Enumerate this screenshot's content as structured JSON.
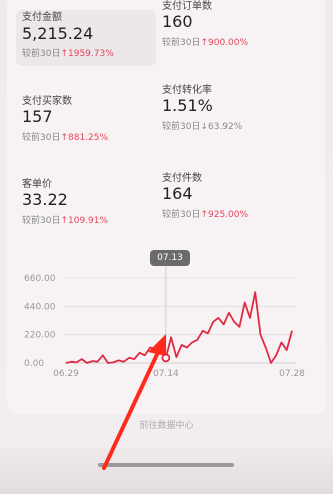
{
  "metrics": [
    {
      "label": "支付金额",
      "value": "5,215.24",
      "compare_prefix": "较前30日",
      "compare_change": "↑1959.73%",
      "direction": "up"
    },
    {
      "label": "支付订单数",
      "value": "160",
      "compare_prefix": "较前30日",
      "compare_change": "↑900.00%",
      "direction": "up"
    },
    {
      "label": "支付买家数",
      "value": "157",
      "compare_prefix": "较前30日",
      "compare_change": "↑881.25%",
      "direction": "up"
    },
    {
      "label": "支付转化率",
      "value": "1.51%",
      "compare_prefix": "较前30日",
      "compare_change": "↓63.92%",
      "direction": "down"
    },
    {
      "label": "客单价",
      "value": "33.22",
      "compare_prefix": "较前30日",
      "compare_change": "↑109.91%",
      "direction": "up"
    },
    {
      "label": "支付件数",
      "value": "164",
      "compare_prefix": "较前30日",
      "compare_change": "↑925.00%",
      "direction": "up"
    }
  ],
  "tooltip": {
    "label": "07.13"
  },
  "footer": {
    "text": "前往数据中心"
  },
  "colors": {
    "line": "#e02a43",
    "arrow": "#ff2a1a",
    "up": "#e6445a"
  },
  "chart_data": {
    "type": "line",
    "x_tick_labels": [
      "06.29",
      "07.14",
      "07.28"
    ],
    "y_tick_labels": [
      "0.00",
      "220.00",
      "440.00",
      "660.00"
    ],
    "ylim": [
      0,
      660
    ],
    "series": [
      {
        "values": [
          0,
          10,
          5,
          30,
          0,
          15,
          10,
          60,
          0,
          5,
          20,
          10,
          40,
          30,
          80,
          60,
          120,
          110,
          130,
          40,
          200,
          45,
          140,
          120,
          160,
          180,
          250,
          230,
          320,
          350,
          300,
          390,
          320,
          280,
          470,
          350,
          550,
          220,
          120,
          0,
          60,
          160,
          100,
          250
        ]
      }
    ],
    "highlight_index": 19
  }
}
